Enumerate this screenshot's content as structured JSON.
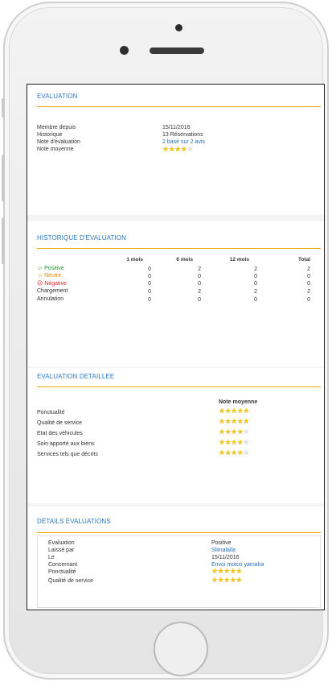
{
  "evaluation": {
    "title": "EVALUATION",
    "rows": [
      {
        "label": "Membre depuis",
        "value": "15/11/2016"
      },
      {
        "label": "Historique",
        "value": "13 Réservations"
      },
      {
        "label": "Note d'évaluation",
        "value": "2 basé sur 2 avis"
      },
      {
        "label": "Note moyenne",
        "value": ""
      }
    ],
    "avg_rating": 4
  },
  "history": {
    "title": "HISTORIQUE D'EVALUATION",
    "columns": [
      "1 mois",
      "6 mois",
      "12 mois",
      "Total"
    ],
    "rows": [
      {
        "label": "Positive",
        "icon": "smile-icon",
        "values": [
          "0",
          "2",
          "2",
          "2"
        ]
      },
      {
        "label": "Neutre",
        "icon": "neutral-face-icon",
        "values": [
          "0",
          "0",
          "0",
          "0"
        ]
      },
      {
        "label": "Négative",
        "icon": "sad-face-icon",
        "values": [
          "0",
          "0",
          "0",
          "0"
        ]
      },
      {
        "label": "Chargement",
        "icon": "",
        "values": [
          "0",
          "2",
          "2",
          "2"
        ]
      },
      {
        "label": "Annulation",
        "icon": "",
        "values": [
          "0",
          "0",
          "0",
          "0"
        ]
      }
    ]
  },
  "detailed": {
    "title": "EVALUATION DETAILLEE",
    "column_header": "Note moyenne",
    "rows": [
      {
        "label": "Ponctualité",
        "rating": 5
      },
      {
        "label": "Qualité de service",
        "rating": 4.5
      },
      {
        "label": "Etat des véhicules",
        "rating": 4
      },
      {
        "label": "Soin apporté aux biens",
        "rating": 3.5
      },
      {
        "label": "Services tels que décrits",
        "rating": 4
      }
    ]
  },
  "details": {
    "title": "DÉTAILS ÉVALUATIONS",
    "rows": [
      {
        "label": "Evaluation",
        "value": "Positive"
      },
      {
        "label": "Laissé par",
        "value": "Slimalalla"
      },
      {
        "label": "Le",
        "value": "15/11/2016"
      },
      {
        "label": "Concernant",
        "value": "Envoi motos yamaha"
      },
      {
        "label": "Ponctualité",
        "value": ""
      },
      {
        "label": "Qualité de service",
        "value": ""
      }
    ],
    "ponctualite_rating": 5,
    "qualite_rating": 5
  },
  "colors": {
    "accent_blue": "#2b79c2",
    "rule_orange": "#f0a500",
    "positive": "#1c9a2a",
    "neutral": "#e68a00",
    "negative": "#d8262c"
  }
}
